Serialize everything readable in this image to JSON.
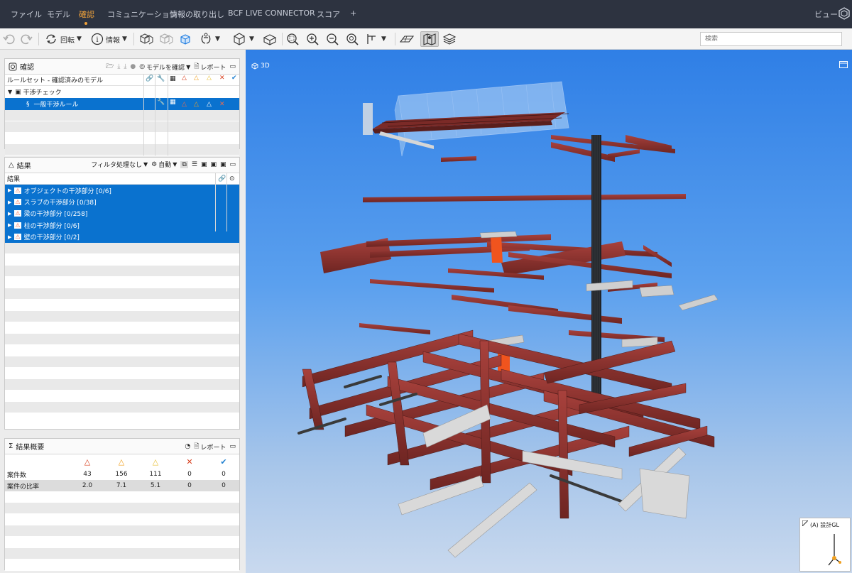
{
  "menu": {
    "items": [
      "ファイル",
      "モデル",
      "確認",
      "コミュニケーション",
      "情報の取り出し",
      "BCF LIVE CONNECTOR",
      "スコア",
      "+"
    ],
    "active": "確認",
    "view_label": "ビュー"
  },
  "toolbar": {
    "rotate_label": "回転",
    "info_label": "情報",
    "search_placeholder": "検索"
  },
  "rules_panel": {
    "title": "確認",
    "check_model_label": "モデルを確認",
    "report_label": "レポート",
    "ruleset_label": "ルールセット - 確認済みのモデル",
    "tree": [
      {
        "label": "干渉チェック",
        "level": 0,
        "selected": false
      },
      {
        "label": "一般干渉ルール",
        "level": 1,
        "selected": true
      }
    ]
  },
  "results_panel": {
    "title": "結果",
    "filter_label": "フィルタ処理なし",
    "auto_label": "自動",
    "col_header": "結果",
    "items": [
      {
        "label": "オブジェクトの干渉部分 [0/6]"
      },
      {
        "label": "スラブの干渉部分 [0/38]"
      },
      {
        "label": "梁の干渉部分 [0/258]"
      },
      {
        "label": "柱の干渉部分 [0/6]"
      },
      {
        "label": "壁の干渉部分 [0/2]"
      }
    ]
  },
  "summary_panel": {
    "title": "結果概要",
    "report_label": "レポート",
    "rows": [
      {
        "label": "案件数",
        "values": [
          "43",
          "156",
          "111",
          "0",
          "0"
        ]
      },
      {
        "label": "案件の比率",
        "values": [
          "2.0",
          "7.1",
          "5.1",
          "0",
          "0"
        ]
      }
    ]
  },
  "viewport": {
    "view_label": "3D",
    "grid_label": "(A) 設計GL"
  },
  "colors": {
    "menubar": "#2d3340",
    "accent": "#f2a33a",
    "selection": "#0a72cf",
    "steel": "#8e2f2b",
    "sky_top": "#2f7fe6",
    "severity_critical": "#d8401f",
    "severity_moderate": "#f0a020",
    "severity_low": "#e8c13a",
    "reject": "#d8401f",
    "accept": "#1e7fd0"
  }
}
